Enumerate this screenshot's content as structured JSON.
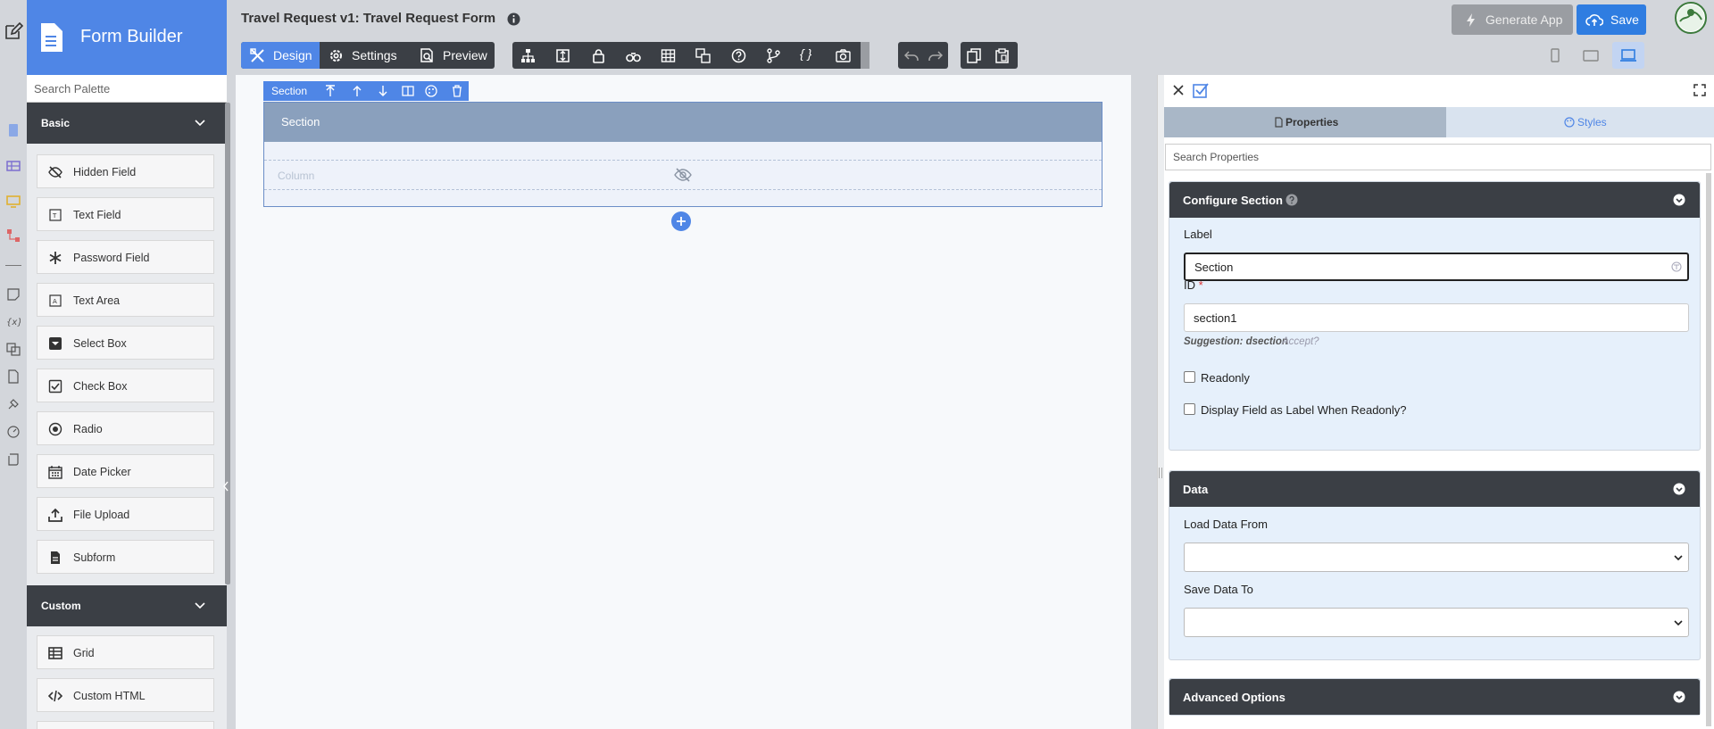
{
  "app": {
    "title": "Form Builder"
  },
  "palette": {
    "search_placeholder": "Search Palette",
    "basic_label": "Basic",
    "custom_label": "Custom",
    "basic_items": [
      "Hidden Field",
      "Text Field",
      "Password Field",
      "Text Area",
      "Select Box",
      "Check Box",
      "Radio",
      "Date Picker",
      "File Upload",
      "Subform"
    ],
    "custom_items": [
      "Grid",
      "Custom HTML"
    ]
  },
  "header": {
    "form_title": "Travel Request v1: Travel Request Form",
    "tabs": {
      "design": "Design",
      "settings": "Settings",
      "preview": "Preview"
    },
    "generate_app": "Generate App",
    "save": "Save",
    "brace_icon_text": "{ }"
  },
  "canvas": {
    "section_toolbar_label": "Section",
    "section_title": "Section",
    "column_label": "Column"
  },
  "properties": {
    "tab_properties": "Properties",
    "tab_styles": "Styles",
    "search_placeholder": "Search Properties",
    "configure_section": {
      "title": "Configure Section",
      "label_label": "Label",
      "label_value": "Section",
      "id_label": "ID",
      "required_mark": "*",
      "id_value": "section1",
      "suggestion_text": "Suggestion: dsection",
      "accept_text": "Accept?",
      "readonly_label": "Readonly",
      "display_field_label": "Display Field as Label When Readonly?"
    },
    "data": {
      "title": "Data",
      "load_from_label": "Load Data From",
      "save_to_label": "Save Data To"
    },
    "advanced": {
      "title": "Advanced Options"
    }
  },
  "colors": {
    "accent": "#4f86e6",
    "dark": "#3b3f45",
    "save": "#2f7de1"
  }
}
